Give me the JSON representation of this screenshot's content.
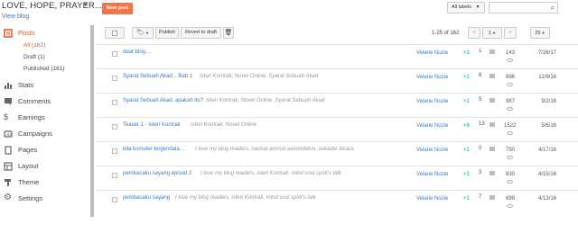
{
  "header": {
    "blog_title": "LOVE, HOPE, PRAYER...",
    "view_blog": "View blog",
    "new_post": "New post",
    "all_labels": "All labels",
    "search_placeholder": ""
  },
  "sidebar": {
    "items": [
      {
        "label": "Posts",
        "icon": "posts-icon"
      },
      {
        "label": "Stats",
        "icon": "stats-icon"
      },
      {
        "label": "Comments",
        "icon": "comments-icon"
      },
      {
        "label": "Earnings",
        "icon": "earnings-icon"
      },
      {
        "label": "Campaigns",
        "icon": "campaigns-icon"
      },
      {
        "label": "Pages",
        "icon": "pages-icon"
      },
      {
        "label": "Layout",
        "icon": "layout-icon"
      },
      {
        "label": "Theme",
        "icon": "theme-icon"
      },
      {
        "label": "Settings",
        "icon": "settings-icon"
      }
    ],
    "subitems": [
      {
        "label": "All (162)"
      },
      {
        "label": "Draft (1)"
      },
      {
        "label": "Published (161)"
      }
    ]
  },
  "toolbar": {
    "publish": "Publish",
    "revert": "Revert to draft",
    "page_info": "1-25 of 162",
    "page_number": "1",
    "per_page": "25"
  },
  "posts": [
    {
      "title": "dear blog...",
      "labels": "",
      "author": "Velarie Nozie",
      "plus": "+1",
      "comments": "1",
      "views": "143",
      "date": "7/26/17"
    },
    {
      "title": "Syarat Sebuah Akad... Bab 1",
      "labels": "Isteri Kontrak, Novel Online, Syarat Sebuah Akad",
      "author": "Velarie Nozie",
      "plus": "+1",
      "comments": "6",
      "views": "896",
      "date": "11/9/16"
    },
    {
      "title": "Syarat Sebuah Akad, apakah itu?",
      "labels": "Isteri Kontrak, Novel Online, Syarat Sebuah Akad",
      "author": "Velarie Nozie",
      "plus": "+1",
      "comments": "5",
      "views": "987",
      "date": "9/2/16"
    },
    {
      "title": "Teaser 1 - Isteri Kontrak",
      "labels": "Isteri Kontrak, Novel Online",
      "author": "Velarie Nozie",
      "plus": "+6",
      "comments": "13",
      "views": "1522",
      "date": "5/6/16"
    },
    {
      "title": "bila komuter tergendala....",
      "labels": "I love my blog readers, nashat ammat aseondidon, sekadar bicara",
      "author": "Velarie Nozie",
      "plus": "+1",
      "comments": "0",
      "views": "750",
      "date": "4/17/16"
    },
    {
      "title": "pembacaku sayang episod 2",
      "labels": "I love my blog readers, isteri Kontrak, mind soul spirit's talk",
      "author": "Velarie Nozie",
      "plus": "+1",
      "comments": "3",
      "views": "830",
      "date": "4/15/16"
    },
    {
      "title": "pembacaku sayang",
      "labels": "I love my blog readers, isteri Kontrak, mind soul spirit's talk",
      "author": "Velarie Nozie",
      "plus": "+1",
      "comments": "7",
      "views": "699",
      "date": "4/13/16"
    }
  ],
  "colors": {
    "accent": "#f4734a",
    "link": "#3b7bbf",
    "active": "#e8531f"
  }
}
